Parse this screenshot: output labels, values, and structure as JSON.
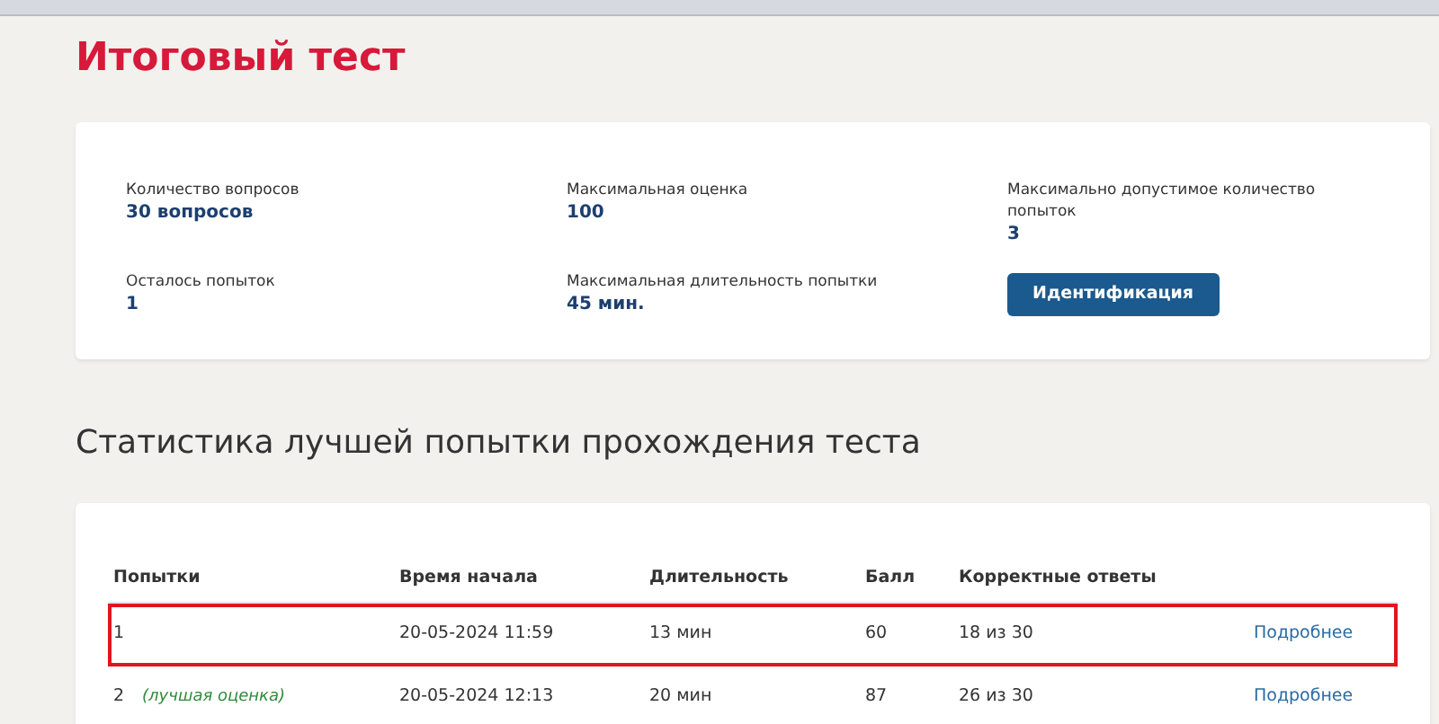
{
  "title": "Итоговый тест",
  "info": [
    {
      "label": "Количество вопросов",
      "value": "30 вопросов",
      "kind": "text"
    },
    {
      "label": "Максимальная оценка",
      "value": "100",
      "kind": "text"
    },
    {
      "label": "Максимально допустимое количество попыток",
      "value": "3",
      "kind": "text"
    },
    {
      "label": "Осталось попыток",
      "value": "1",
      "kind": "text"
    },
    {
      "label": "Максимальная длительность попытки",
      "value": "45 мин.",
      "kind": "text"
    },
    {
      "label": "Идентификация",
      "kind": "button"
    }
  ],
  "stats_heading": "Статистика лучшей попытки прохождения теста",
  "table": {
    "columns": [
      "Попытки",
      "Время начала",
      "Длительность",
      "Балл",
      "Корректные ответы"
    ],
    "rows": [
      {
        "attempt": "1",
        "start": "20-05-2024 11:59",
        "duration": "13 мин",
        "score": "60",
        "correct": "18 из 30",
        "link": "Подробнее",
        "highlighted": true
      },
      {
        "attempt": "2",
        "note": "(лучшая оценка)",
        "start": "20-05-2024 12:13",
        "duration": "20 мин",
        "score": "87",
        "correct": "26 из 30",
        "link": "Подробнее",
        "highlighted": false
      }
    ]
  }
}
